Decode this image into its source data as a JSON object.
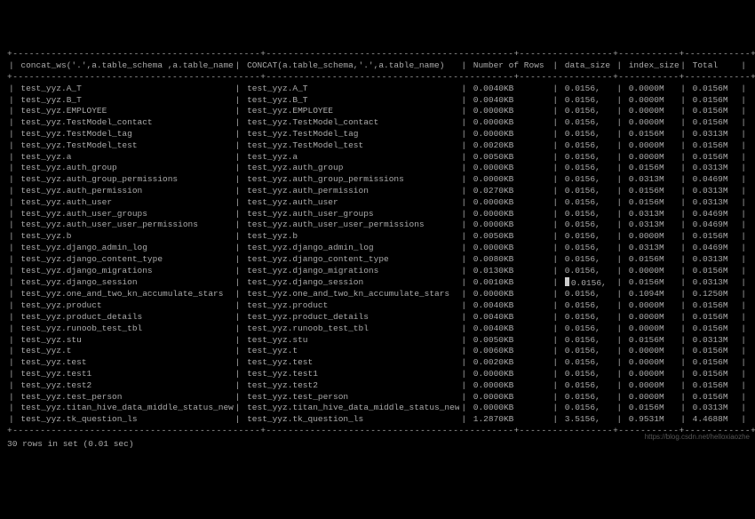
{
  "headers": {
    "c0": "concat_ws('.',a.table_schema ,a.table_name)",
    "c1": "CONCAT(a.table_schema,'.',a.table_name)",
    "c2": "Number of Rows",
    "c3": "data_size",
    "c4": "index_size",
    "c5": "Total"
  },
  "separator": "+---------------------------------------------+---------------------------------------------+-----------------+-----------+------------+---------+",
  "rows": [
    {
      "c0": "test_yyz.A_T",
      "c1": "test_yyz.A_T",
      "c2": "0.0040KB",
      "c3": "0.0156,",
      "c4": "0.0000M",
      "c5": "0.0156M"
    },
    {
      "c0": "test_yyz.B_T",
      "c1": "test_yyz.B_T",
      "c2": "0.0040KB",
      "c3": "0.0156,",
      "c4": "0.0000M",
      "c5": "0.0156M"
    },
    {
      "c0": "test_yyz.EMPLOYEE",
      "c1": "test_yyz.EMPLOYEE",
      "c2": "0.0000KB",
      "c3": "0.0156,",
      "c4": "0.0000M",
      "c5": "0.0156M"
    },
    {
      "c0": "test_yyz.TestModel_contact",
      "c1": "test_yyz.TestModel_contact",
      "c2": "0.0000KB",
      "c3": "0.0156,",
      "c4": "0.0000M",
      "c5": "0.0156M"
    },
    {
      "c0": "test_yyz.TestModel_tag",
      "c1": "test_yyz.TestModel_tag",
      "c2": "0.0000KB",
      "c3": "0.0156,",
      "c4": "0.0156M",
      "c5": "0.0313M"
    },
    {
      "c0": "test_yyz.TestModel_test",
      "c1": "test_yyz.TestModel_test",
      "c2": "0.0020KB",
      "c3": "0.0156,",
      "c4": "0.0000M",
      "c5": "0.0156M"
    },
    {
      "c0": "test_yyz.a",
      "c1": "test_yyz.a",
      "c2": "0.0050KB",
      "c3": "0.0156,",
      "c4": "0.0000M",
      "c5": "0.0156M"
    },
    {
      "c0": "test_yyz.auth_group",
      "c1": "test_yyz.auth_group",
      "c2": "0.0000KB",
      "c3": "0.0156,",
      "c4": "0.0156M",
      "c5": "0.0313M"
    },
    {
      "c0": "test_yyz.auth_group_permissions",
      "c1": "test_yyz.auth_group_permissions",
      "c2": "0.0000KB",
      "c3": "0.0156,",
      "c4": "0.0313M",
      "c5": "0.0469M"
    },
    {
      "c0": "test_yyz.auth_permission",
      "c1": "test_yyz.auth_permission",
      "c2": "0.0270KB",
      "c3": "0.0156,",
      "c4": "0.0156M",
      "c5": "0.0313M"
    },
    {
      "c0": "test_yyz.auth_user",
      "c1": "test_yyz.auth_user",
      "c2": "0.0000KB",
      "c3": "0.0156,",
      "c4": "0.0156M",
      "c5": "0.0313M"
    },
    {
      "c0": "test_yyz.auth_user_groups",
      "c1": "test_yyz.auth_user_groups",
      "c2": "0.0000KB",
      "c3": "0.0156,",
      "c4": "0.0313M",
      "c5": "0.0469M"
    },
    {
      "c0": "test_yyz.auth_user_user_permissions",
      "c1": "test_yyz.auth_user_user_permissions",
      "c2": "0.0000KB",
      "c3": "0.0156,",
      "c4": "0.0313M",
      "c5": "0.0469M"
    },
    {
      "c0": "test_yyz.b",
      "c1": "test_yyz.b",
      "c2": "0.0050KB",
      "c3": "0.0156,",
      "c4": "0.0000M",
      "c5": "0.0156M"
    },
    {
      "c0": "test_yyz.django_admin_log",
      "c1": "test_yyz.django_admin_log",
      "c2": "0.0000KB",
      "c3": "0.0156,",
      "c4": "0.0313M",
      "c5": "0.0469M"
    },
    {
      "c0": "test_yyz.django_content_type",
      "c1": "test_yyz.django_content_type",
      "c2": "0.0080KB",
      "c3": "0.0156,",
      "c4": "0.0156M",
      "c5": "0.0313M"
    },
    {
      "c0": "test_yyz.django_migrations",
      "c1": "test_yyz.django_migrations",
      "c2": "0.0130KB",
      "c3": "0.0156,",
      "c4": "0.0000M",
      "c5": "0.0156M"
    },
    {
      "c0": "test_yyz.django_session",
      "c1": "test_yyz.django_session",
      "c2": "0.0010KB",
      "c3": "0.0156,",
      "c4": "0.0156M",
      "c5": "0.0313M",
      "cursor": true
    },
    {
      "c0": "test_yyz.one_and_two_kn_accumulate_stars",
      "c1": "test_yyz.one_and_two_kn_accumulate_stars",
      "c2": "0.0000KB",
      "c3": "0.0156,",
      "c4": "0.1094M",
      "c5": "0.1250M"
    },
    {
      "c0": "test_yyz.product",
      "c1": "test_yyz.product",
      "c2": "0.0040KB",
      "c3": "0.0156,",
      "c4": "0.0000M",
      "c5": "0.0156M"
    },
    {
      "c0": "test_yyz.product_details",
      "c1": "test_yyz.product_details",
      "c2": "0.0040KB",
      "c3": "0.0156,",
      "c4": "0.0000M",
      "c5": "0.0156M"
    },
    {
      "c0": "test_yyz.runoob_test_tbl",
      "c1": "test_yyz.runoob_test_tbl",
      "c2": "0.0040KB",
      "c3": "0.0156,",
      "c4": "0.0000M",
      "c5": "0.0156M"
    },
    {
      "c0": "test_yyz.stu",
      "c1": "test_yyz.stu",
      "c2": "0.0050KB",
      "c3": "0.0156,",
      "c4": "0.0156M",
      "c5": "0.0313M"
    },
    {
      "c0": "test_yyz.t",
      "c1": "test_yyz.t",
      "c2": "0.0060KB",
      "c3": "0.0156,",
      "c4": "0.0000M",
      "c5": "0.0156M"
    },
    {
      "c0": "test_yyz.test",
      "c1": "test_yyz.test",
      "c2": "0.0020KB",
      "c3": "0.0156,",
      "c4": "0.0000M",
      "c5": "0.0156M"
    },
    {
      "c0": "test_yyz.test1",
      "c1": "test_yyz.test1",
      "c2": "0.0000KB",
      "c3": "0.0156,",
      "c4": "0.0000M",
      "c5": "0.0156M"
    },
    {
      "c0": "test_yyz.test2",
      "c1": "test_yyz.test2",
      "c2": "0.0000KB",
      "c3": "0.0156,",
      "c4": "0.0000M",
      "c5": "0.0156M"
    },
    {
      "c0": "test_yyz.test_person",
      "c1": "test_yyz.test_person",
      "c2": "0.0000KB",
      "c3": "0.0156,",
      "c4": "0.0000M",
      "c5": "0.0156M"
    },
    {
      "c0": "test_yyz.titan_hive_data_middle_status_new",
      "c1": "test_yyz.titan_hive_data_middle_status_new",
      "c2": "0.0000KB",
      "c3": "0.0156,",
      "c4": "0.0156M",
      "c5": "0.0313M"
    },
    {
      "c0": "test_yyz.tk_question_ls",
      "c1": "test_yyz.tk_question_ls",
      "c2": "1.2870KB",
      "c3": "3.5156,",
      "c4": "0.9531M",
      "c5": "4.4688M"
    }
  ],
  "footer": "30 rows in set (0.01 sec)",
  "watermark": "https://blog.csdn.net/helloxiaozhe"
}
